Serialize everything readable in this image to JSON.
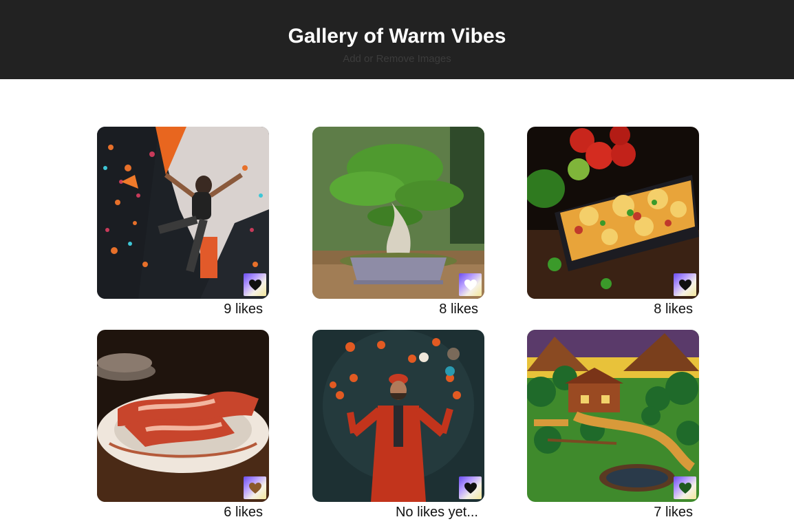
{
  "header": {
    "title": "Gallery of Warm Vibes",
    "subtitle": "Add or Remove Images"
  },
  "gallery": [
    {
      "name": "climber",
      "likes_label": "9 likes",
      "heart_color": "#111111"
    },
    {
      "name": "bonsai",
      "likes_label": "8 likes",
      "heart_color": "#ffffff"
    },
    {
      "name": "lasagna",
      "likes_label": "8 likes",
      "heart_color": "#111111"
    },
    {
      "name": "bacon",
      "likes_label": "6 likes",
      "heart_color": "#8a5a2b"
    },
    {
      "name": "juggler",
      "likes_label": "No likes yet...",
      "heart_color": "#111111"
    },
    {
      "name": "pixel-farm",
      "likes_label": "7 likes",
      "heart_color": "#1f5a1f"
    }
  ],
  "icons": {
    "like": "heart-icon"
  }
}
